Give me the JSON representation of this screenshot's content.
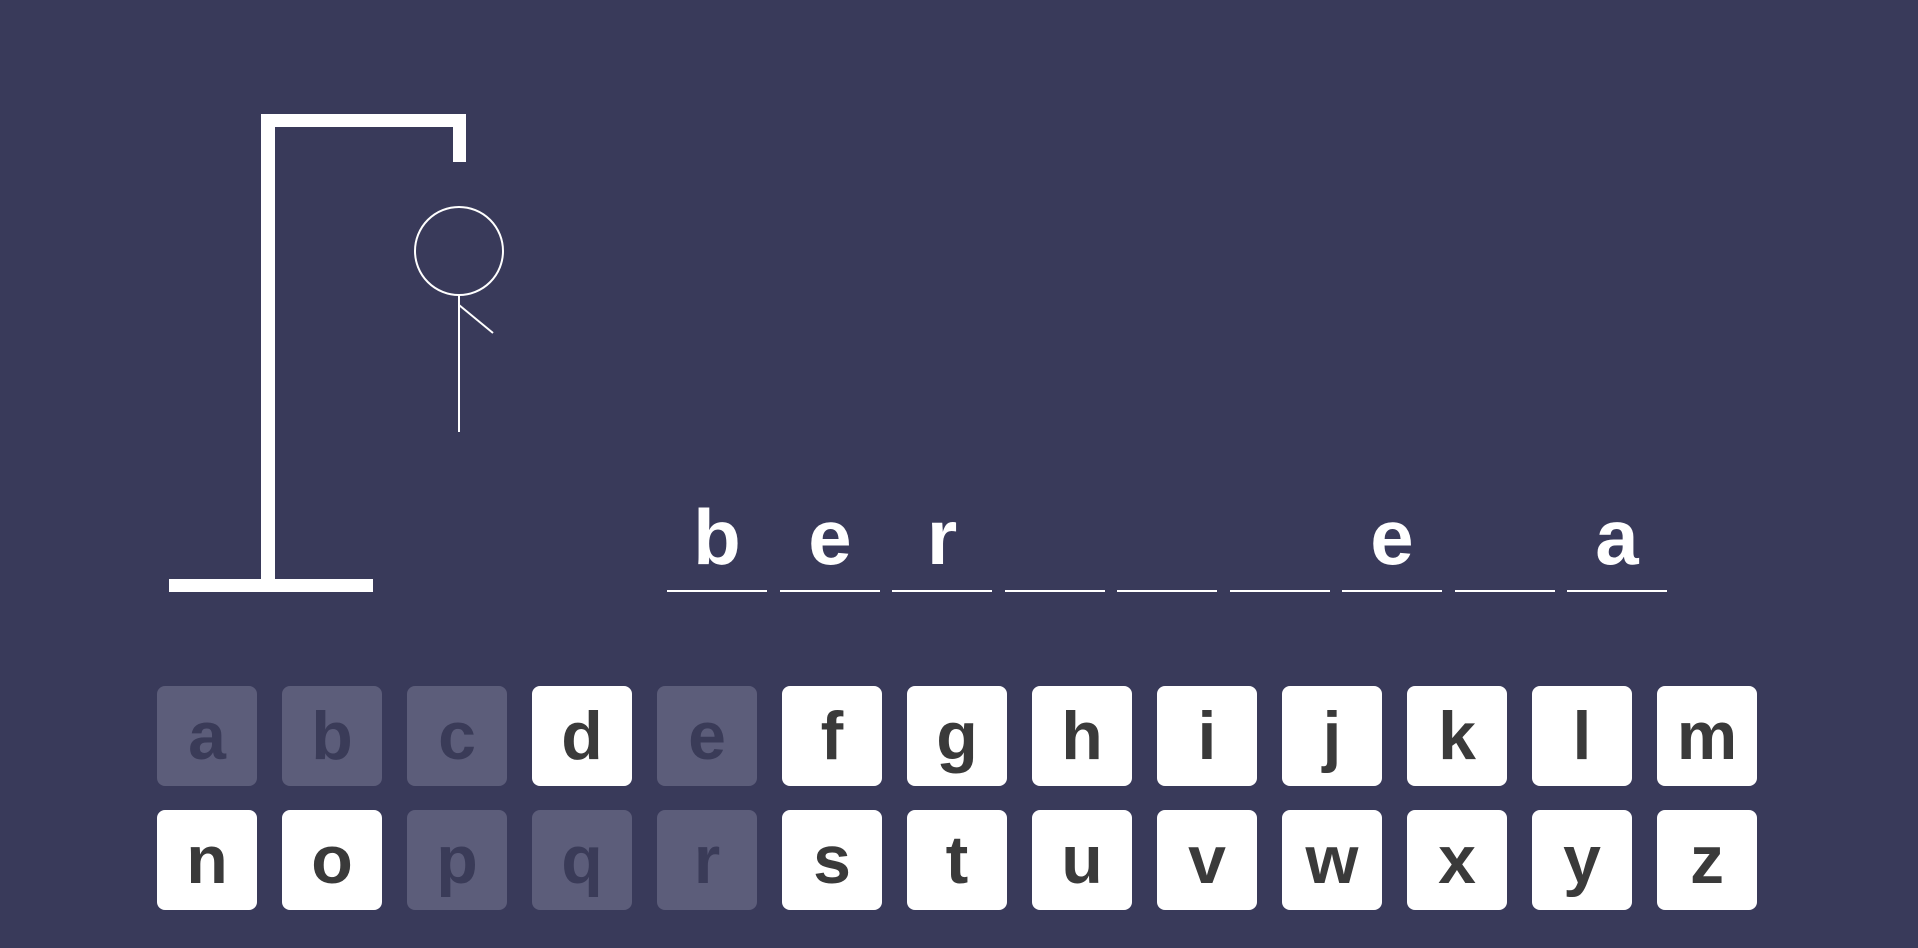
{
  "colors": {
    "background": "#393a5a",
    "key_available": "#ffffff",
    "key_used": "#5c5d7a",
    "key_text": "#3a3a3a",
    "foreground": "#ffffff"
  },
  "hangman": {
    "parts_drawn": [
      "head",
      "body",
      "right-arm"
    ]
  },
  "word": {
    "slots": [
      "b",
      "e",
      "r",
      "",
      "",
      "",
      "e",
      "",
      "a"
    ]
  },
  "keyboard": {
    "keys": [
      {
        "letter": "a",
        "used": true
      },
      {
        "letter": "b",
        "used": true
      },
      {
        "letter": "c",
        "used": true
      },
      {
        "letter": "d",
        "used": false
      },
      {
        "letter": "e",
        "used": true
      },
      {
        "letter": "f",
        "used": false
      },
      {
        "letter": "g",
        "used": false
      },
      {
        "letter": "h",
        "used": false
      },
      {
        "letter": "i",
        "used": false
      },
      {
        "letter": "j",
        "used": false
      },
      {
        "letter": "k",
        "used": false
      },
      {
        "letter": "l",
        "used": false
      },
      {
        "letter": "m",
        "used": false
      },
      {
        "letter": "n",
        "used": false
      },
      {
        "letter": "o",
        "used": false
      },
      {
        "letter": "p",
        "used": true
      },
      {
        "letter": "q",
        "used": true
      },
      {
        "letter": "r",
        "used": true
      },
      {
        "letter": "s",
        "used": false
      },
      {
        "letter": "t",
        "used": false
      },
      {
        "letter": "u",
        "used": false
      },
      {
        "letter": "v",
        "used": false
      },
      {
        "letter": "w",
        "used": false
      },
      {
        "letter": "x",
        "used": false
      },
      {
        "letter": "y",
        "used": false
      },
      {
        "letter": "z",
        "used": false
      }
    ]
  }
}
